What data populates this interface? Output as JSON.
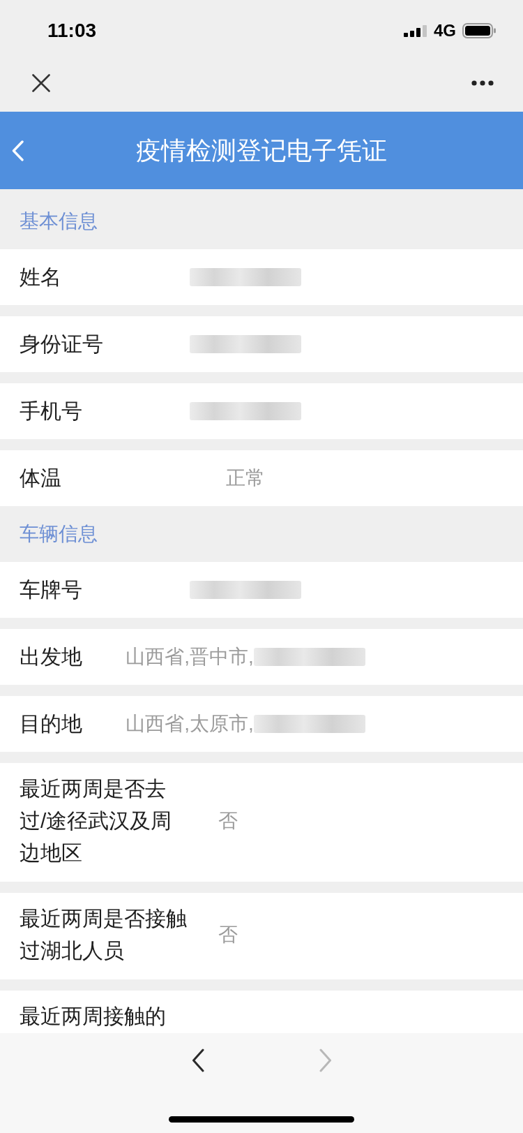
{
  "status_bar": {
    "time": "11:03",
    "network": "4G"
  },
  "header": {
    "title": "疫情检测登记电子凭证"
  },
  "sections": [
    {
      "title": "基本信息",
      "rows": [
        {
          "kind": "short",
          "label": "姓名",
          "redacted": true
        },
        {
          "kind": "short",
          "label": "身份证号",
          "redacted": true
        },
        {
          "kind": "short",
          "label": "手机号",
          "redacted": true
        },
        {
          "kind": "short",
          "label": "体温",
          "value": "正常"
        }
      ]
    },
    {
      "title": "车辆信息",
      "rows": [
        {
          "kind": "short",
          "label": "车牌号",
          "redacted": true
        },
        {
          "kind": "short",
          "label": "出发地",
          "value": "山西省,晋中市,",
          "redacted": true
        },
        {
          "kind": "short",
          "label": "目的地",
          "value": "山西省,太原市,",
          "redacted": true
        },
        {
          "kind": "long",
          "label": "最近两周是否去过/途径武汉及周边地区",
          "value": "否"
        },
        {
          "kind": "long",
          "label": "最近两周是否接触过湖北人员",
          "value": "否"
        },
        {
          "kind": "long",
          "label": "最近两周接触的"
        }
      ]
    }
  ],
  "toolbar": [
    {
      "kind": "back",
      "disabled": false
    },
    {
      "kind": "forward",
      "disabled": true
    }
  ]
}
